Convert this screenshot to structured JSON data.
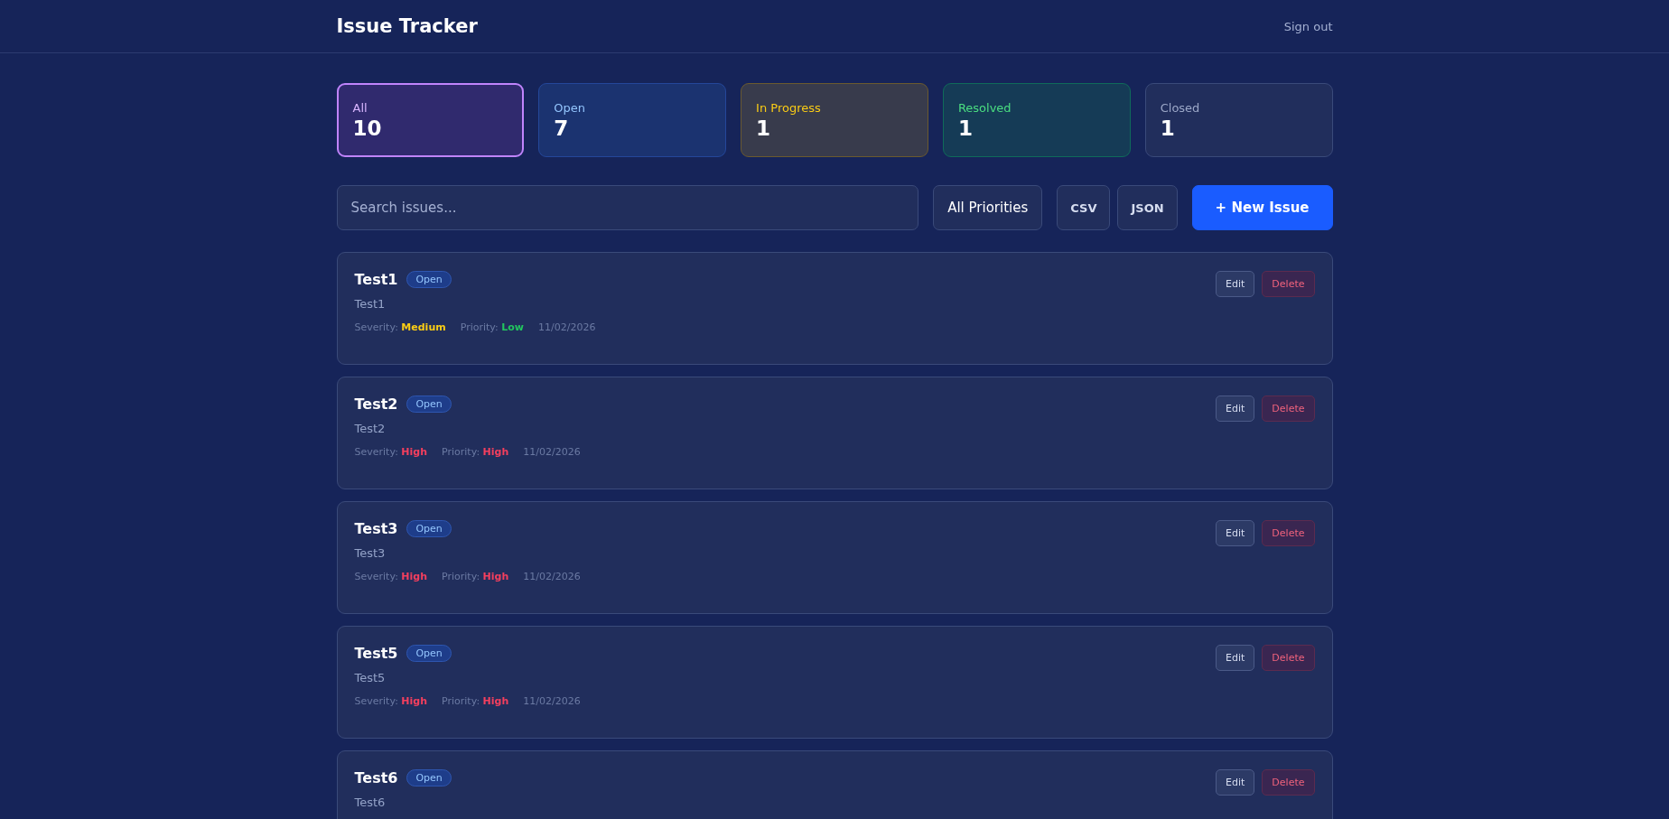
{
  "header": {
    "title": "Issue Tracker",
    "sign_out": "Sign out"
  },
  "stats": [
    {
      "label": "All",
      "count": "10",
      "kind": "all",
      "selected": true
    },
    {
      "label": "Open",
      "count": "7",
      "kind": "open",
      "selected": false
    },
    {
      "label": "In Progress",
      "count": "1",
      "kind": "progress",
      "selected": false
    },
    {
      "label": "Resolved",
      "count": "1",
      "kind": "resolved",
      "selected": false
    },
    {
      "label": "Closed",
      "count": "1",
      "kind": "closed",
      "selected": false
    }
  ],
  "toolbar": {
    "search": {
      "placeholder": "Search issues..."
    },
    "priority_filter": "All Priorities",
    "export_buttons": [
      "CSV",
      "JSON"
    ],
    "new_button": "+ New Issue"
  },
  "issues": [
    {
      "title": "Test1",
      "status": "Open",
      "description": "Test1",
      "severity_label": "Severity:",
      "severity": {
        "text": "Medium",
        "color": "#facc15"
      },
      "priority_label": "Priority:",
      "priority": {
        "text": "Low",
        "color": "#22c55e"
      },
      "date": "11/02/2026",
      "edit": "Edit",
      "delete": "Delete"
    },
    {
      "title": "Test2",
      "status": "Open",
      "description": "Test2",
      "severity_label": "Severity:",
      "severity": {
        "text": "High",
        "color": "#f43f5e"
      },
      "priority_label": "Priority:",
      "priority": {
        "text": "High",
        "color": "#f43f5e"
      },
      "date": "11/02/2026",
      "edit": "Edit",
      "delete": "Delete"
    },
    {
      "title": "Test3",
      "status": "Open",
      "description": "Test3",
      "severity_label": "Severity:",
      "severity": {
        "text": "High",
        "color": "#f43f5e"
      },
      "priority_label": "Priority:",
      "priority": {
        "text": "High",
        "color": "#f43f5e"
      },
      "date": "11/02/2026",
      "edit": "Edit",
      "delete": "Delete"
    },
    {
      "title": "Test5",
      "status": "Open",
      "description": "Test5",
      "severity_label": "Severity:",
      "severity": {
        "text": "High",
        "color": "#f43f5e"
      },
      "priority_label": "Priority:",
      "priority": {
        "text": "High",
        "color": "#f43f5e"
      },
      "date": "11/02/2026",
      "edit": "Edit",
      "delete": "Delete"
    },
    {
      "title": "Test6",
      "status": "Open",
      "description": "Test6",
      "edit": "Edit",
      "delete": "Delete"
    }
  ]
}
